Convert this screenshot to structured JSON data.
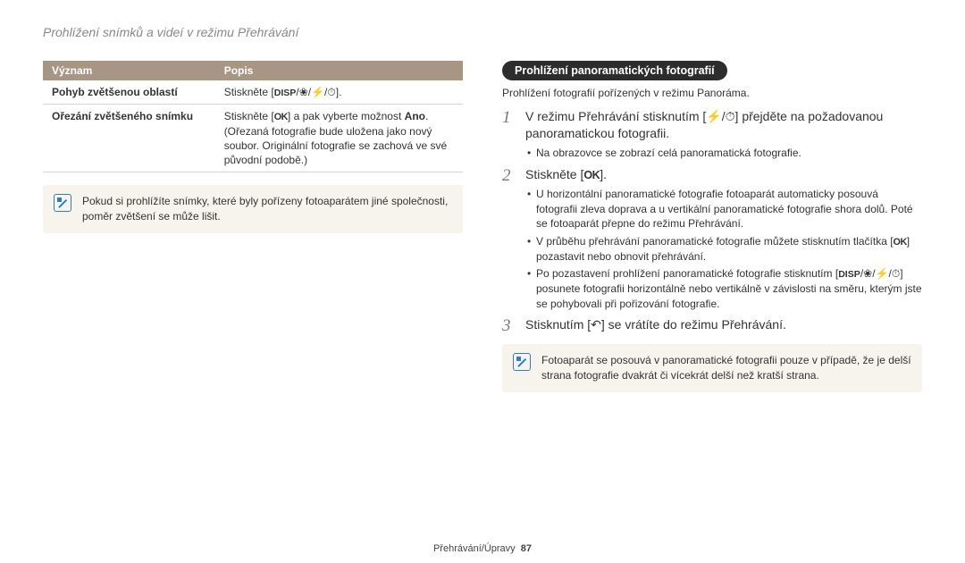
{
  "page_title": "Prohlížení snímků a videí v režimu Přehrávání",
  "table": {
    "headers": {
      "term": "Význam",
      "desc": "Popis"
    },
    "rows": [
      {
        "term": "Pohyb zvětšenou oblastí",
        "desc_pre": "Stiskněte [",
        "desc_post": "]."
      },
      {
        "term": "Ořezání zvětšeného snímku",
        "desc_pre": "Stiskněte [",
        "desc_mid": "] a pak vyberte možnost ",
        "desc_bold": "Ano",
        "desc_end": ".",
        "line2": "(Ořezaná fotografie bude uložena jako nový soubor. Originální fotografie se zachová ve své původní podobě.)"
      }
    ]
  },
  "left_note": "Pokud si prohlížíte snímky, které byly pořízeny fotoaparátem jiné společnosti, poměr zvětšení se může lišit.",
  "section_heading": "Prohlížení panoramatických fotografií",
  "section_lead": "Prohlížení fotografií pořízených v režimu Panoráma.",
  "steps": {
    "s1_pre": "V režimu Přehrávání stisknutím [",
    "s1_post": "] přejděte na požadovanou panoramatickou fotografii.",
    "s1_bul1": "Na obrazovce se zobrazí celá panoramatická fotografie.",
    "s2_pre": "Stiskněte [",
    "s2_post": "].",
    "s2_bul1": "U horizontální panoramatické fotografie fotoaparát automaticky posouvá fotografii zleva doprava a u vertikální panoramatické fotografie shora dolů. Poté se fotoaparát přepne do režimu Přehrávání.",
    "s2_bul2_pre": "V průběhu přehrávání panoramatické fotografie můžete stisknutím tlačítka [",
    "s2_bul2_post": "] pozastavit nebo obnovit přehrávání.",
    "s2_bul3_pre": "Po pozastavení prohlížení panoramatické fotografie stisknutím [",
    "s2_bul3_post": "] posunete fotografii horizontálně nebo vertikálně v závislosti na směru, kterým jste se pohybovali při pořizování fotografie.",
    "s3_pre": "Stisknutím [",
    "s3_post": "] se vrátíte do režimu Přehrávání."
  },
  "right_note": "Fotoaparát se posouvá v panoramatické fotografii pouze v případě, že je delší strana fotografie dvakrát či vícekrát delší než kratší strana.",
  "footer": {
    "section": "Přehrávání/Úpravy",
    "page": "87"
  },
  "icons": {
    "disp": "DISP",
    "ok": "OK",
    "flower": "❀",
    "flash": "⚡",
    "timer": "⏱",
    "return": "↶"
  }
}
